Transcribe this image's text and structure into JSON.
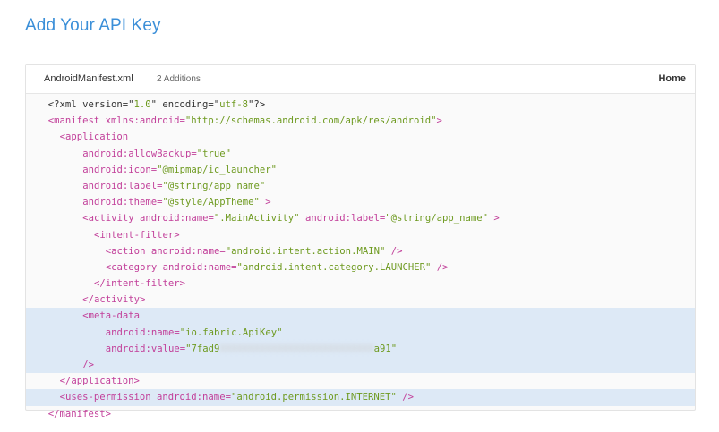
{
  "page": {
    "title": "Add Your API Key"
  },
  "panel": {
    "file_name": "AndroidManifest.xml",
    "additions": "2 Additions",
    "home_label": "Home"
  },
  "code": {
    "lines": [
      {
        "indent": 2,
        "highlight": false,
        "parts": [
          {
            "c": "plain",
            "t": "<?xml version=\""
          },
          {
            "c": "val",
            "t": "1.0"
          },
          {
            "c": "plain",
            "t": "\" encoding=\""
          },
          {
            "c": "val",
            "t": "utf-8"
          },
          {
            "c": "plain",
            "t": "\"?>"
          }
        ]
      },
      {
        "indent": 2,
        "highlight": false,
        "parts": [
          {
            "c": "tag",
            "t": "<manifest "
          },
          {
            "c": "attr",
            "t": "xmlns:android="
          },
          {
            "c": "val",
            "t": "\"http://schemas.android.com/apk/res/android\""
          },
          {
            "c": "tag",
            "t": ">"
          }
        ]
      },
      {
        "indent": 4,
        "highlight": false,
        "parts": [
          {
            "c": "tag",
            "t": "<application"
          }
        ]
      },
      {
        "indent": 8,
        "highlight": false,
        "parts": [
          {
            "c": "attr",
            "t": "android:allowBackup="
          },
          {
            "c": "val",
            "t": "\"true\""
          }
        ]
      },
      {
        "indent": 8,
        "highlight": false,
        "parts": [
          {
            "c": "attr",
            "t": "android:icon="
          },
          {
            "c": "val",
            "t": "\"@mipmap/ic_launcher\""
          }
        ]
      },
      {
        "indent": 8,
        "highlight": false,
        "parts": [
          {
            "c": "attr",
            "t": "android:label="
          },
          {
            "c": "val",
            "t": "\"@string/app_name\""
          }
        ]
      },
      {
        "indent": 8,
        "highlight": false,
        "parts": [
          {
            "c": "attr",
            "t": "android:theme="
          },
          {
            "c": "val",
            "t": "\"@style/AppTheme\""
          },
          {
            "c": "tag",
            "t": " >"
          }
        ]
      },
      {
        "indent": 8,
        "highlight": false,
        "parts": [
          {
            "c": "tag",
            "t": "<activity "
          },
          {
            "c": "attr",
            "t": "android:name="
          },
          {
            "c": "val",
            "t": "\".MainActivity\""
          },
          {
            "c": "attr",
            "t": " android:label="
          },
          {
            "c": "val",
            "t": "\"@string/app_name\""
          },
          {
            "c": "tag",
            "t": " >"
          }
        ]
      },
      {
        "indent": 10,
        "highlight": false,
        "parts": [
          {
            "c": "tag",
            "t": "<intent-filter>"
          }
        ]
      },
      {
        "indent": 12,
        "highlight": false,
        "parts": [
          {
            "c": "tag",
            "t": "<action "
          },
          {
            "c": "attr",
            "t": "android:name="
          },
          {
            "c": "val",
            "t": "\"android.intent.action.MAIN\""
          },
          {
            "c": "tag",
            "t": " />"
          }
        ]
      },
      {
        "indent": 12,
        "highlight": false,
        "parts": [
          {
            "c": "tag",
            "t": "<category "
          },
          {
            "c": "attr",
            "t": "android:name="
          },
          {
            "c": "val",
            "t": "\"android.intent.category.LAUNCHER\""
          },
          {
            "c": "tag",
            "t": " />"
          }
        ]
      },
      {
        "indent": 10,
        "highlight": false,
        "parts": [
          {
            "c": "tag",
            "t": "</intent-filter>"
          }
        ]
      },
      {
        "indent": 8,
        "highlight": false,
        "parts": [
          {
            "c": "tag",
            "t": "</activity>"
          }
        ]
      },
      {
        "indent": 8,
        "highlight": true,
        "parts": [
          {
            "c": "tag",
            "t": "<meta-data"
          }
        ]
      },
      {
        "indent": 12,
        "highlight": true,
        "parts": [
          {
            "c": "attr",
            "t": "android:name="
          },
          {
            "c": "val",
            "t": "\"io.fabric.ApiKey\""
          }
        ]
      },
      {
        "indent": 12,
        "highlight": true,
        "parts": [
          {
            "c": "attr",
            "t": "android:value="
          },
          {
            "c": "val",
            "t": "\"7fad9"
          },
          {
            "c": "blurred",
            "t": "XXXXXXXXXXXXXXXXXXXXXXXXXXX"
          },
          {
            "c": "val",
            "t": "a91\""
          }
        ]
      },
      {
        "indent": 8,
        "highlight": true,
        "parts": [
          {
            "c": "tag",
            "t": "/>"
          }
        ]
      },
      {
        "indent": 4,
        "highlight": false,
        "parts": [
          {
            "c": "tag",
            "t": "</application>"
          }
        ]
      },
      {
        "indent": 4,
        "highlight": true,
        "parts": [
          {
            "c": "tag",
            "t": "<uses-permission "
          },
          {
            "c": "attr",
            "t": "android:name="
          },
          {
            "c": "val",
            "t": "\"android.permission.INTERNET\""
          },
          {
            "c": "tag",
            "t": " />"
          }
        ]
      },
      {
        "indent": 2,
        "highlight": false,
        "parts": [
          {
            "c": "tag",
            "t": "</manifest>"
          }
        ]
      }
    ]
  }
}
